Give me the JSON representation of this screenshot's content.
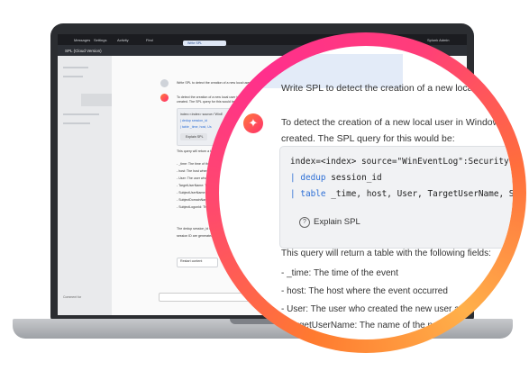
{
  "app": {
    "menu": [
      "Messages",
      "Settings",
      "Activity",
      "Find"
    ],
    "user": "Splunk Admin",
    "title": "SPL (Cloud Version)",
    "input_hint": "Comment for"
  },
  "chat": {
    "user_message": "Write SPL to detect the creation of a new local user in",
    "assistant_intro_1": "To detect the creation of a new local user in Windows, we ca",
    "assistant_intro_2": "created. The SPL query for this would be:",
    "code": {
      "line1": "index=<index> source=\"WinEventLog\":Security AN",
      "line2_pipe": "|",
      "line2_cmd": "dedup",
      "line2_rest": "session_id",
      "line3_pipe": "|",
      "line3_cmd": "table",
      "line3_rest": "_time, host, User, TargetUserName, Subj"
    },
    "explain_label": "Explain SPL",
    "fields_intro": "This query will return a table with the following fields:",
    "fields": [
      "- _time: The time of the event",
      "- host: The host where the event occurred",
      "- User: The user who created the new user accou",
      "- TargetUserName: The name of the new"
    ],
    "regenerate_label": "Restart content",
    "mini_user_message": "Write SPL to detect the creation of a new local user in W",
    "mini_intro": "To detect the creation of a new local user in Wi...",
    "mini_intro2": "created. The SPL query for this would be:",
    "mini_code1": "index=<index> source=\"WinE",
    "mini_code2": "| dedup session_id",
    "mini_code3": "| table _time, host, Us",
    "mini_explain": "Explain SPL",
    "mini_lines": [
      "This query will return a table",
      "- _time: The time of the ev",
      "- host: The host where the e",
      "- User: The user who create",
      "- TargetUserName: The na",
      "- SubjectUserName: The use",
      "- SubjectDomainName: The",
      "- SubjectLogonId: The logo",
      "The dedup session_id com",
      "session ID are generated for"
    ],
    "mini_tab": "Write SPL"
  }
}
